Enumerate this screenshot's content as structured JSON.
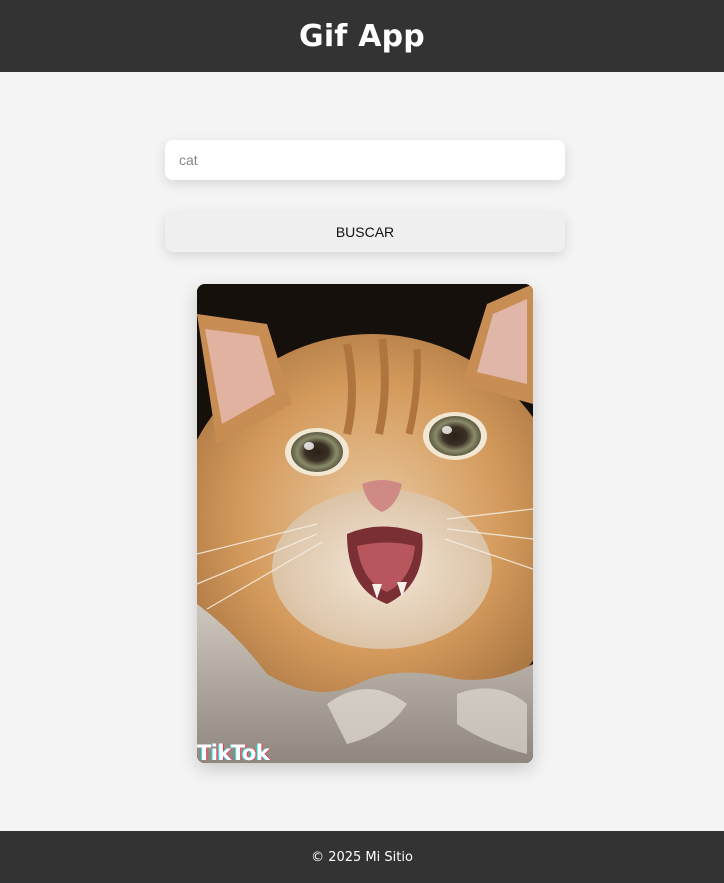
{
  "header": {
    "title": "Gif App"
  },
  "search": {
    "value": "",
    "placeholder": "cat",
    "button_label": "BUSCAR"
  },
  "results": [
    {
      "type": "gif",
      "subject": "cat",
      "watermark": "TikTok"
    }
  ],
  "footer": {
    "text": "© 2025 Mi Sitio"
  },
  "colors": {
    "header_bg": "#333333",
    "page_bg": "#f4f4f4",
    "footer_bg": "#333333"
  }
}
